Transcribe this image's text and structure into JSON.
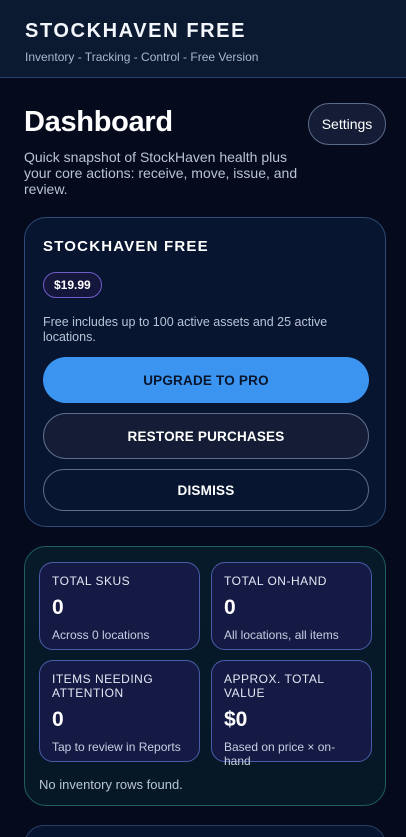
{
  "header": {
    "title": "STOCKHAVEN FREE",
    "subtitle": "Inventory - Tracking - Control - Free Version"
  },
  "dashboard": {
    "title": "Dashboard",
    "settings_label": "Settings",
    "description": "Quick snapshot of StockHaven health plus your core actions: receive, move, issue, and review."
  },
  "promo": {
    "title": "STOCKHAVEN FREE",
    "price": "$19.99",
    "description": "Free includes up to 100 active assets and 25 active locations.",
    "upgrade_label": "UPGRADE TO PRO",
    "restore_label": "RESTORE PURCHASES",
    "dismiss_label": "DISMISS"
  },
  "stats": {
    "items": [
      {
        "label": "TOTAL SKUS",
        "value": "0",
        "note": "Across 0 locations"
      },
      {
        "label": "TOTAL ON-HAND",
        "value": "0",
        "note": "All locations, all items"
      },
      {
        "label": "ITEMS NEEDING ATTENTION",
        "value": "0",
        "note": "Tap to review in Reports"
      },
      {
        "label": "APPROX. TOTAL VALUE",
        "value": "$0",
        "note": "Based on price × on-hand"
      }
    ],
    "empty_message": "No inventory rows found."
  },
  "colors": {
    "background": "#050a1c",
    "accent": "#3b95f0",
    "card_border": "#2d4a78",
    "stat_border": "#4a5ca8"
  }
}
